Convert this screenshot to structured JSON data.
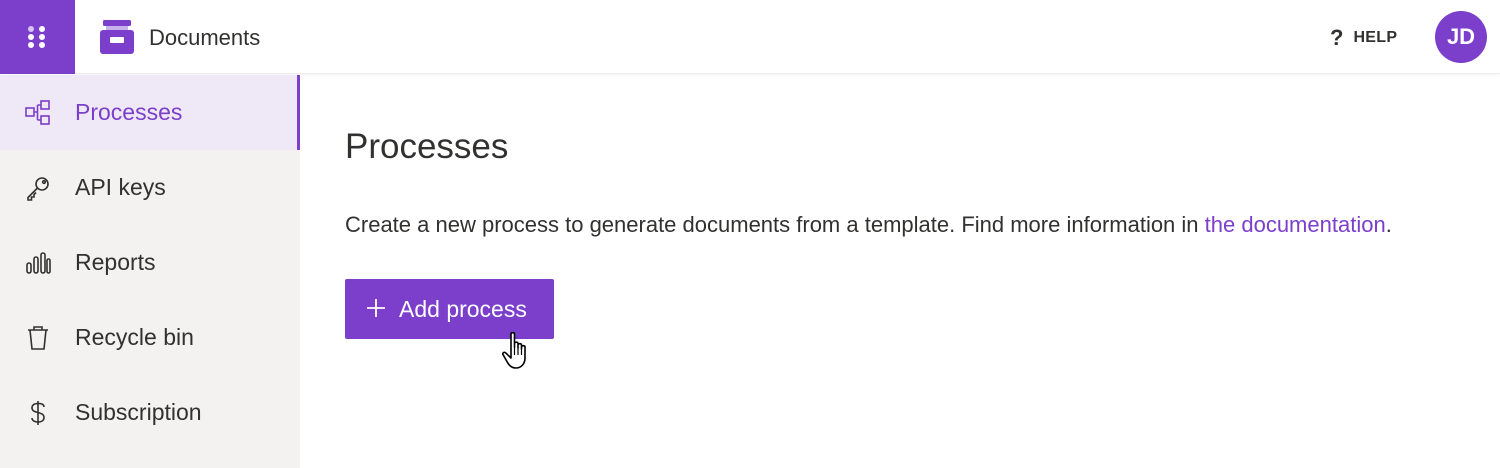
{
  "header": {
    "app_title": "Documents",
    "help_label": "HELP",
    "help_icon": "?",
    "avatar_initials": "JD"
  },
  "sidebar": {
    "items": [
      {
        "label": "Processes",
        "icon": "processes-icon",
        "active": true
      },
      {
        "label": "API keys",
        "icon": "key-icon",
        "active": false
      },
      {
        "label": "Reports",
        "icon": "bar-chart-icon",
        "active": false
      },
      {
        "label": "Recycle bin",
        "icon": "trash-icon",
        "active": false
      },
      {
        "label": "Subscription",
        "icon": "dollar-icon",
        "active": false
      }
    ]
  },
  "main": {
    "title": "Processes",
    "description": "Create a new process to generate documents from a template. Find more information in ",
    "link_text": "the documentation",
    "description_end": ".",
    "add_button_label": "Add process"
  },
  "colors": {
    "accent": "#7b3fcc",
    "sidebar_bg": "#f3f2f1",
    "active_bg": "#eee8f7",
    "text": "#323130"
  }
}
